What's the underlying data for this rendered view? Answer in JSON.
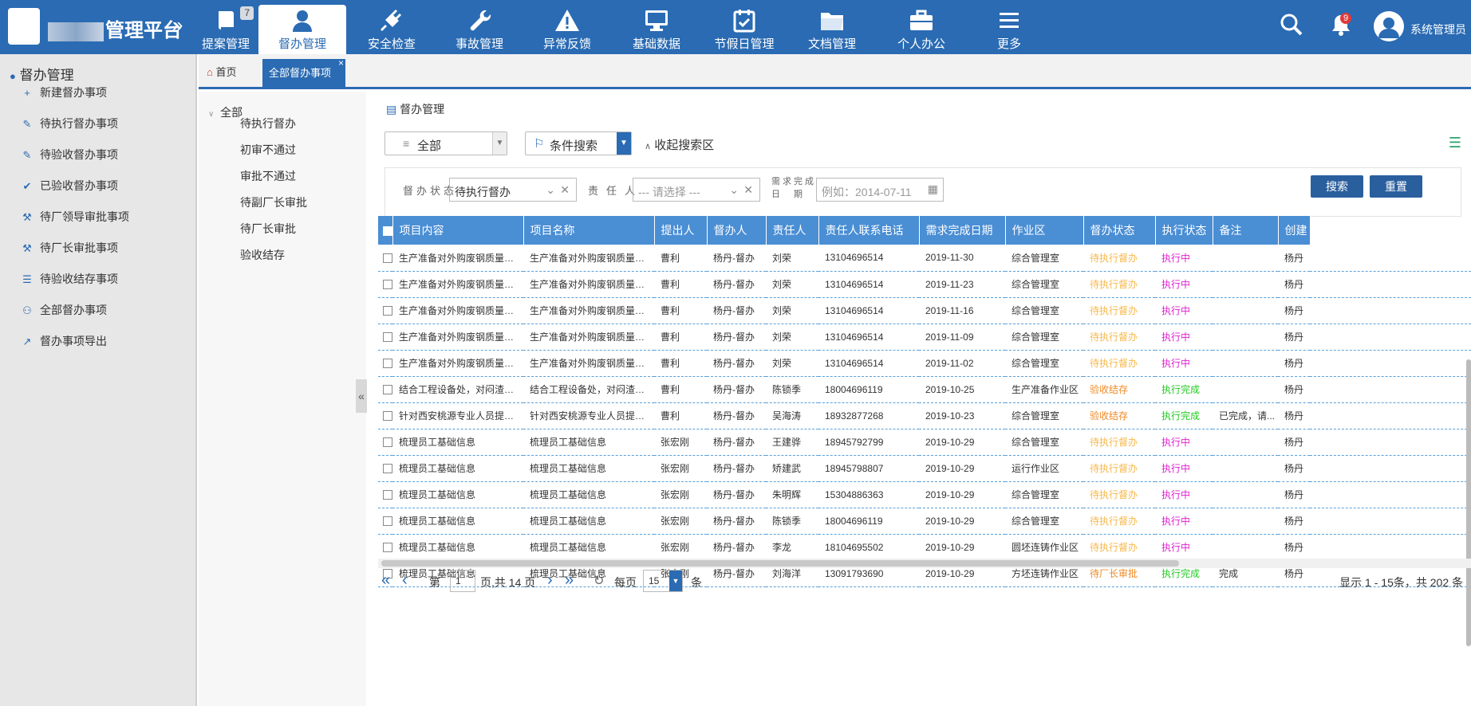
{
  "header": {
    "brand": "管理平台",
    "collapse": "»",
    "nav": [
      {
        "label": "提案管理",
        "icon": "book-icon",
        "badge": "7"
      },
      {
        "label": "督办管理",
        "icon": "user-icon",
        "active": true
      },
      {
        "label": "安全检查",
        "icon": "plug-icon"
      },
      {
        "label": "事故管理",
        "icon": "wrench-icon"
      },
      {
        "label": "异常反馈",
        "icon": "warning-icon"
      },
      {
        "label": "基础数据",
        "icon": "monitor-icon"
      },
      {
        "label": "节假日管理",
        "icon": "calendar-icon"
      },
      {
        "label": "文档管理",
        "icon": "folder-icon"
      },
      {
        "label": "个人办公",
        "icon": "briefcase-icon"
      },
      {
        "label": "更多",
        "icon": "menu-icon"
      }
    ],
    "bell_badge": "9",
    "username": "系统管理员",
    "toggle": "≈"
  },
  "sidebar": {
    "title": "督办管理",
    "items": [
      {
        "label": "新建督办事项",
        "icon": "plus-icon",
        "glyph": "+"
      },
      {
        "label": "待执行督办事项",
        "icon": "pencil-icon",
        "glyph": "✎"
      },
      {
        "label": "待验收督办事项",
        "icon": "brush-icon",
        "glyph": "✎"
      },
      {
        "label": "已验收督办事项",
        "icon": "check-icon",
        "glyph": "✔"
      },
      {
        "label": "待厂领导审批事项",
        "icon": "wrench-icon",
        "glyph": "⚒"
      },
      {
        "label": "待厂长审批事项",
        "icon": "gavel-icon",
        "glyph": "⚒"
      },
      {
        "label": "待验收结存事项",
        "icon": "list-icon",
        "glyph": "☰"
      },
      {
        "label": "全部督办事项",
        "icon": "users-icon",
        "glyph": "⚇"
      },
      {
        "label": "督办事项导出",
        "icon": "share-icon",
        "glyph": "↗"
      }
    ]
  },
  "tabs": {
    "home": "首页",
    "active": "全部督办事项",
    "close": "×"
  },
  "tree": {
    "root": "全部",
    "items": [
      "待执行督办",
      "初审不通过",
      "审批不通过",
      "待副厂长审批",
      "待厂长审批",
      "验收结存"
    ],
    "collapse": "«"
  },
  "panel": {
    "title": "督办管理",
    "scope": "全部",
    "cond_search": "条件搜索",
    "collapse_search": "收起搜索区"
  },
  "filters": {
    "status_label": "督办状态",
    "status_value": "待执行督办",
    "person_label": "责任人",
    "person_placeholder": "--- 请选择 ---",
    "date_label_1": "需求完成",
    "date_label_2": "日　期",
    "date_placeholder": "例如：2014-07-11",
    "search_btn": "搜索",
    "reset_btn": "重置"
  },
  "table": {
    "headers": [
      "项目内容",
      "项目名称",
      "提出人",
      "督办人",
      "责任人",
      "责任人联系电话",
      "需求完成日期",
      "作业区",
      "督办状态",
      "执行状态",
      "备注",
      "创建"
    ],
    "rows": [
      [
        "生产准备对外购废钢质量、需...",
        "生产准备对外购废钢质量、需...",
        "曹利",
        "杨丹-督办",
        "刘荣",
        "13104696514",
        "2019-11-30",
        "综合管理室",
        "待执行督办",
        "执行中",
        "",
        "杨丹"
      ],
      [
        "生产准备对外购废钢质量、需...",
        "生产准备对外购废钢质量、需...",
        "曹利",
        "杨丹-督办",
        "刘荣",
        "13104696514",
        "2019-11-23",
        "综合管理室",
        "待执行督办",
        "执行中",
        "",
        "杨丹"
      ],
      [
        "生产准备对外购废钢质量、需...",
        "生产准备对外购废钢质量、需...",
        "曹利",
        "杨丹-督办",
        "刘荣",
        "13104696514",
        "2019-11-16",
        "综合管理室",
        "待执行督办",
        "执行中",
        "",
        "杨丹"
      ],
      [
        "生产准备对外购废钢质量、需...",
        "生产准备对外购废钢质量、需...",
        "曹利",
        "杨丹-督办",
        "刘荣",
        "13104696514",
        "2019-11-09",
        "综合管理室",
        "待执行督办",
        "执行中",
        "",
        "杨丹"
      ],
      [
        "生产准备对外购废钢质量、需...",
        "生产准备对外购废钢质量、需...",
        "曹利",
        "杨丹-督办",
        "刘荣",
        "13104696514",
        "2019-11-02",
        "综合管理室",
        "待执行督办",
        "执行中",
        "",
        "杨丹"
      ],
      [
        "结合工程设备处，对闷渣池修...",
        "结合工程设备处，对闷渣池修...",
        "曹利",
        "杨丹-督办",
        "陈锁季",
        "18004696119",
        "2019-10-25",
        "生产准备作业区",
        "验收结存",
        "执行完成",
        "",
        "杨丹"
      ],
      [
        "针对西安桃源专业人员提出的...",
        "针对西安桃源专业人员提出的...",
        "曹利",
        "杨丹-督办",
        "吴海涛",
        "18932877268",
        "2019-10-23",
        "综合管理室",
        "验收结存",
        "执行完成",
        "已完成，请...",
        "杨丹"
      ],
      [
        "梳理员工基础信息",
        "梳理员工基础信息",
        "张宏刚",
        "杨丹-督办",
        "王建骅",
        "18945792799",
        "2019-10-29",
        "综合管理室",
        "待执行督办",
        "执行中",
        "",
        "杨丹"
      ],
      [
        "梳理员工基础信息",
        "梳理员工基础信息",
        "张宏刚",
        "杨丹-督办",
        "矫建武",
        "18945798807",
        "2019-10-29",
        "运行作业区",
        "待执行督办",
        "执行中",
        "",
        "杨丹"
      ],
      [
        "梳理员工基础信息",
        "梳理员工基础信息",
        "张宏刚",
        "杨丹-督办",
        "朱明辉",
        "15304886363",
        "2019-10-29",
        "综合管理室",
        "待执行督办",
        "执行中",
        "",
        "杨丹"
      ],
      [
        "梳理员工基础信息",
        "梳理员工基础信息",
        "张宏刚",
        "杨丹-督办",
        "陈锁季",
        "18004696119",
        "2019-10-29",
        "综合管理室",
        "待执行督办",
        "执行中",
        "",
        "杨丹"
      ],
      [
        "梳理员工基础信息",
        "梳理员工基础信息",
        "张宏刚",
        "杨丹-督办",
        "李龙",
        "18104695502",
        "2019-10-29",
        "圆坯连铸作业区",
        "待执行督办",
        "执行中",
        "",
        "杨丹"
      ],
      [
        "梳理员工基础信息",
        "梳理员工基础信息",
        "张宏刚",
        "杨丹-督办",
        "刘海洋",
        "13091793690",
        "2019-10-29",
        "方坯连铸作业区",
        "待厂长审批",
        "执行完成",
        "完成",
        "杨丹"
      ]
    ],
    "status_colors": {
      "待执行督办": "#f7b84b",
      "验收结存": "#f08a24",
      "待厂长审批": "#f08a24"
    },
    "exec_colors": {
      "执行中": "#e020d0",
      "执行完成": "#22cc22"
    }
  },
  "pager": {
    "page_prefix": "第",
    "page": "1",
    "page_suffix": "页,共 14 页",
    "per_page_label": "每页",
    "per_page": "15",
    "unit": "条",
    "summary": "显示 1 - 15条，共 202 条"
  }
}
